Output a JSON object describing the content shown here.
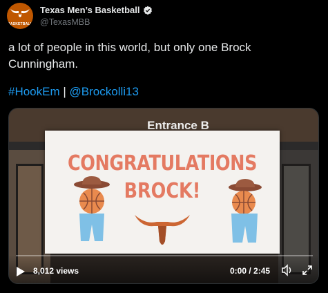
{
  "author": {
    "display_name": "Texas Men’s Basketball",
    "handle": "@TexasMBB",
    "avatar_text": "BASKETBALL",
    "verified_icon": "verified-badge-icon"
  },
  "tweet": {
    "text": "a lot of people in this world, but only one Brock Cunningham.",
    "hashtag": "#HookEm",
    "separator": "|",
    "mention": "@Brockolli13"
  },
  "media": {
    "sign": "Entrance B",
    "poster_line1": "CONGRATULATIONS",
    "poster_line2": "BROCK!",
    "views": "8,012 views",
    "time": "0:00 / 2:45",
    "progress": 0
  },
  "colors": {
    "accent": "#1d9bf0",
    "brand": "#bf5700",
    "poster_text": "#e47a62"
  }
}
